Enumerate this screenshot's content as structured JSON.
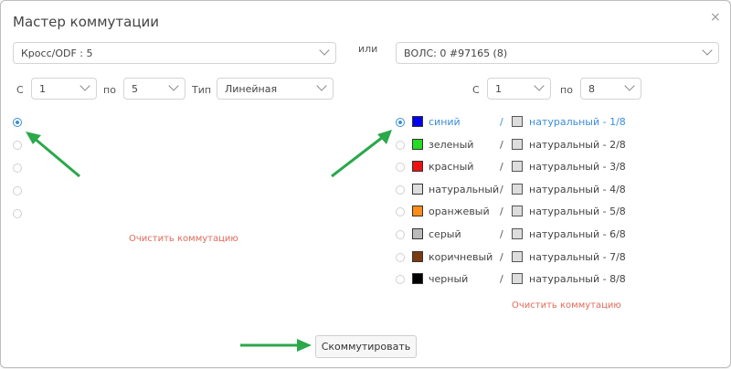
{
  "dialog": {
    "title": "Мастер коммутации",
    "close_glyph": "×"
  },
  "top": {
    "left_select": "Кросс/ODF : 5",
    "or_label": "или",
    "right_select": "ВОЛС: 0 #97165 (8)"
  },
  "left_range": {
    "from_label": "С",
    "from_value": "1",
    "to_label": "по",
    "to_value": "5",
    "type_label": "Тип",
    "type_value": "Линейная"
  },
  "right_range": {
    "from_label": "С",
    "from_value": "1",
    "to_label": "по",
    "to_value": "8"
  },
  "left_radios": [
    {
      "checked": true
    },
    {
      "checked": false
    },
    {
      "checked": false
    },
    {
      "checked": false
    },
    {
      "checked": false
    }
  ],
  "fibers": [
    {
      "name": "синий",
      "color": "#0000ee",
      "pair_color": "#dddddd",
      "pair": "натуральный - 1/8",
      "selected": true
    },
    {
      "name": "зеленый",
      "color": "#22dd22",
      "pair_color": "#dddddd",
      "pair": "натуральный - 2/8",
      "selected": false
    },
    {
      "name": "красный",
      "color": "#ee1111",
      "pair_color": "#dddddd",
      "pair": "натуральный - 3/8",
      "selected": false
    },
    {
      "name": "натуральный",
      "color": "#dddddd",
      "pair_color": "#dddddd",
      "pair": "натуральный - 4/8",
      "selected": false
    },
    {
      "name": "оранжевый",
      "color": "#ff8c1a",
      "pair_color": "#dddddd",
      "pair": "натуральный - 5/8",
      "selected": false
    },
    {
      "name": "серый",
      "color": "#bbbbbb",
      "pair_color": "#dddddd",
      "pair": "натуральный - 6/8",
      "selected": false
    },
    {
      "name": "коричневый",
      "color": "#7a3a10",
      "pair_color": "#dddddd",
      "pair": "натуральный - 7/8",
      "selected": false
    },
    {
      "name": "черный",
      "color": "#000000",
      "pair_color": "#dddddd",
      "pair": "натуральный - 8/8",
      "selected": false
    }
  ],
  "fiber_separator": "/",
  "left_clear_link": "Очистить коммутацию",
  "right_clear_link": "Очистить коммутацию",
  "submit_button": "Скоммутировать",
  "colors": {
    "accent": "#3b8ed8",
    "link": "#e06a5a",
    "arrow": "#2aa84a"
  }
}
